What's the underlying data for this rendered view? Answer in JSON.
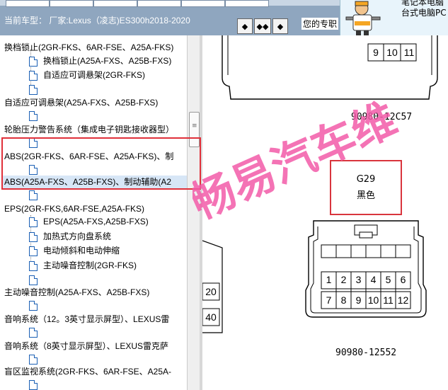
{
  "header": {
    "car_type_label": "当前车型：  厂家:Lexus（凌志)ES300h2018-2020",
    "nav_prev": "◆",
    "nav_both": "◆◆",
    "nav_next": "◆",
    "pro_label": "您的专职"
  },
  "ad": {
    "line1": "笔记本电脑",
    "line2": "台式电脑PC"
  },
  "tree": {
    "rows": [
      {
        "label": "换档锁止(2GR-FKS、6AR-FSE、A25A-FKS)"
      },
      {
        "label": "换档锁止(A25A-FXS、A25B-FXS)"
      },
      {
        "label": "自适应可调悬架(2GR-FKS)"
      },
      {
        "label": "自适应可调悬架(A25A-FXS、A25B-FXS)"
      },
      {
        "label": "轮胎压力警告系统（集成电子钥匙接收器型）"
      },
      {
        "label": "ABS(2GR-FKS、6AR-FSE、A25A-FKS)、制"
      },
      {
        "label": "ABS(A25A-FXS、A25B-FXS)、制动辅助(A2"
      },
      {
        "label": "EPS(2GR-FKS,6AR-FSE,A25A-FKS)"
      },
      {
        "label": "EPS(A25A-FXS,A25B-FXS)"
      },
      {
        "label": "加热式方向盘系统"
      },
      {
        "label": "电动倾斜和电动伸缩"
      },
      {
        "label": "主动噪音控制(2GR-FKS)"
      },
      {
        "label": "主动噪音控制(A25A-FXS、A25B-FXS)"
      },
      {
        "label": "音响系统（12。3英寸显示屏型）、LEXUS雷"
      },
      {
        "label": "音响系统（8英寸显示屏型）、LEXUS雷克萨"
      },
      {
        "label": "盲区监视系统(2GR-FKS、6AR-FSE、A25A-"
      }
    ]
  },
  "diagram": {
    "connector_top_pins": [
      "9",
      "10",
      "11"
    ],
    "connector_top_part": "90980-12C57",
    "g29_code": "G29",
    "g29_color": "黑色",
    "connector_pins_row1": [
      "1",
      "2",
      "3",
      "4",
      "5",
      "6"
    ],
    "connector_pins_row2": [
      "7",
      "8",
      "9",
      "10",
      "11",
      "12"
    ],
    "connector_bottom_part": "90980-12552",
    "left_pins": [
      "20",
      "40"
    ]
  },
  "watermark": "畅易汽车维"
}
